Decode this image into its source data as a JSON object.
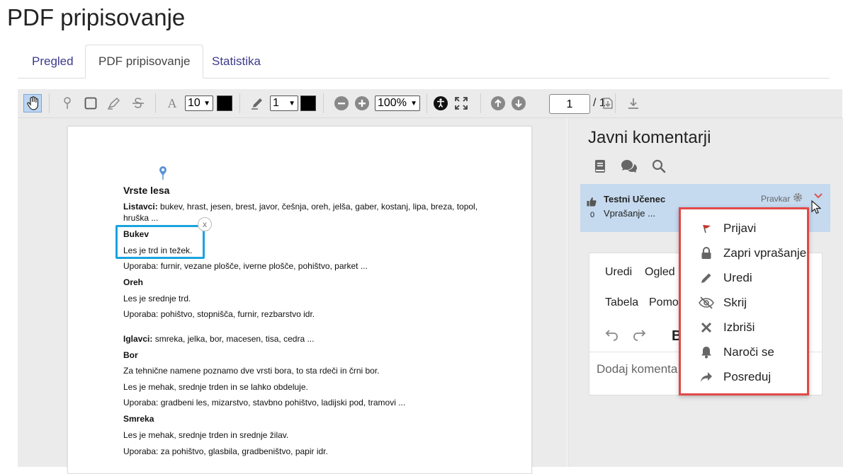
{
  "page": {
    "title": "PDF pripisovanje"
  },
  "tabs": [
    {
      "label": "Pregled",
      "active": false
    },
    {
      "label": "PDF pripisovanje",
      "active": true
    },
    {
      "label": "Statistika",
      "active": false
    }
  ],
  "toolbar": {
    "font_size": "10",
    "font_color": "#000000",
    "line_width": "1",
    "line_color": "#000000",
    "zoom": "100%",
    "page_current": "1",
    "page_total": "/ 1"
  },
  "pdf": {
    "lines": [
      {
        "text": "Vrste lesa",
        "style": "h"
      },
      {
        "text": "Listavci: bukev, hrast, jesen, brest, javor, češnja, oreh, jelša, gaber, kostanj, lipa, breza, topol,",
        "style": "mixed",
        "bold_part": "Listavci:",
        "rest": " bukev, hrast, jesen, brest, javor, češnja, oreh, jelša, gaber, kostanj, lipa, breza, topol,"
      },
      {
        "text": "hruška ...",
        "style": "normal"
      },
      {
        "text": "Bukev",
        "style": "bold"
      },
      {
        "text": "Les je trd in težek.",
        "style": "normal"
      },
      {
        "text": "Uporaba: furnir, vezane plošče, iverne plošče, pohištvo, parket ...",
        "style": "normal"
      },
      {
        "text": "Oreh",
        "style": "bold"
      },
      {
        "text": "Les je srednje trd.",
        "style": "normal"
      },
      {
        "text": "Uporaba: pohištvo, stopnišča, furnir, rezbarstvo idr.",
        "style": "normal"
      },
      {
        "text": "Iglavci: smreka, jelka, bor, macesen, tisa, cedra ...",
        "style": "mixed",
        "bold_part": "Iglavci:",
        "rest": " smreka, jelka, bor, macesen, tisa, cedra ..."
      },
      {
        "text": "Bor",
        "style": "bold"
      },
      {
        "text": "Za tehnične namene poznamo dve vrsti bora, to sta rdeči in črni bor.",
        "style": "normal"
      },
      {
        "text": "Les je mehak, srednje trden in se lahko obdeluje.",
        "style": "normal"
      },
      {
        "text": "Uporaba: gradbeni les, mizarstvo, stavbno pohištvo, ladijski pod, tramovi ...",
        "style": "normal"
      },
      {
        "text": "Smreka",
        "style": "bold"
      },
      {
        "text": "Les je mehak, srednje trden in srednje žilav.",
        "style": "normal"
      },
      {
        "text": "Uporaba: za pohištvo, glasbila, gradbeništvo, papir idr.",
        "style": "normal"
      }
    ],
    "annotation_close": "x"
  },
  "panel": {
    "title": "Javni komentarji",
    "comment": {
      "author": "Testni Učenec",
      "text": "Vprašanje ...",
      "likes": "0",
      "role": "Pravkar"
    },
    "editor": {
      "menu": [
        "Uredi",
        "Ogled"
      ],
      "menu2": [
        "Tabela",
        "Pomoč"
      ],
      "bold_label": "B",
      "placeholder": "Dodaj komenta"
    }
  },
  "dropdown": {
    "items": [
      {
        "label": "Prijavi",
        "icon": "flag-icon"
      },
      {
        "label": "Zapri vprašanje",
        "icon": "lock-icon"
      },
      {
        "label": "Uredi",
        "icon": "pencil-icon"
      },
      {
        "label": "Skrij",
        "icon": "eye-slash-icon"
      },
      {
        "label": "Izbriši",
        "icon": "x-icon"
      },
      {
        "label": "Naroči se",
        "icon": "bell-icon"
      },
      {
        "label": "Posreduj",
        "icon": "share-icon"
      }
    ]
  },
  "colors": {
    "accent": "#3b3a8c",
    "selection": "#1aa3e0",
    "comment_bg": "#c5d9ef",
    "dropdown_border": "#e04848",
    "flag": "#c0392b"
  }
}
